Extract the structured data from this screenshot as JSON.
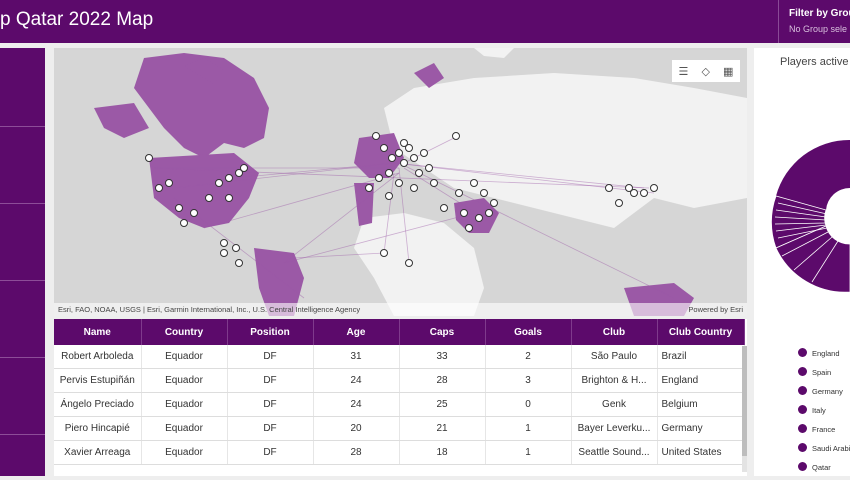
{
  "header": {
    "title": "p Qatar 2022 Map",
    "filter_title": "Filter by Group",
    "filter_value": "No Group sele"
  },
  "map": {
    "attribution": "Esri, FAO, NOAA, USGS | Esri, Garmin International, Inc., U.S. Central Intelligence Agency",
    "powered_by": "Powered by Esri",
    "tools": [
      "list-icon",
      "layers-icon",
      "qr-grid-icon"
    ]
  },
  "table": {
    "columns": [
      "Name",
      "Country",
      "Position",
      "Age",
      "Caps",
      "Goals",
      "Club",
      "Club Country"
    ],
    "rows": [
      [
        "Robert Arboleda",
        "Equador",
        "DF",
        "31",
        "33",
        "2",
        "São Paulo",
        "Brazil"
      ],
      [
        "Pervis Estupiñán",
        "Equador",
        "DF",
        "24",
        "28",
        "3",
        "Brighton & H...",
        "England"
      ],
      [
        "Ángelo Preciado",
        "Equador",
        "DF",
        "24",
        "25",
        "0",
        "Genk",
        "Belgium"
      ],
      [
        "Piero Hincapié",
        "Equador",
        "DF",
        "20",
        "21",
        "1",
        "Bayer Leverku...",
        "Germany"
      ],
      [
        "Xavier Arreaga",
        "Equador",
        "DF",
        "28",
        "18",
        "1",
        "Seattle Sound...",
        "United States"
      ]
    ]
  },
  "right_panel": {
    "title": "Players active",
    "legend": [
      "England",
      "Spain",
      "Germany",
      "Italy",
      "France",
      "Saudi Arabia",
      "Qatar"
    ]
  },
  "colors": {
    "brand_purple": "#5c0a6b",
    "map_land": "#9b59a6",
    "map_background": "#d6d6d6"
  }
}
